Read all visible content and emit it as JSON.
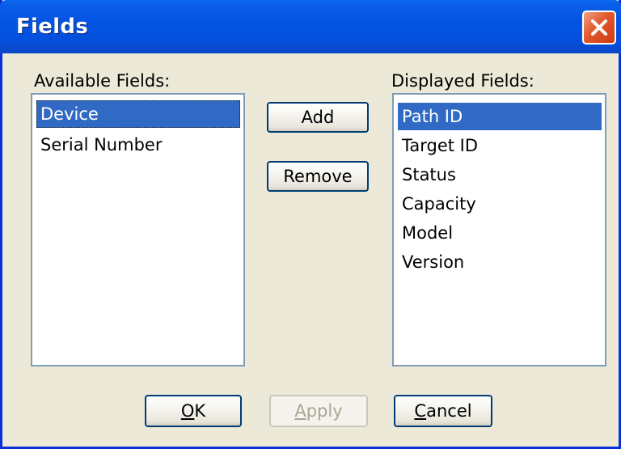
{
  "window": {
    "title": "Fields"
  },
  "available": {
    "label": "Available Fields:",
    "items": [
      "Device",
      "Serial Number"
    ]
  },
  "displayed": {
    "label": "Displayed Fields:",
    "items": [
      "Path ID",
      "Target ID",
      "Status",
      "Capacity",
      "Model",
      "Version"
    ]
  },
  "middle_buttons": {
    "add": "Add",
    "remove": "Remove"
  },
  "footer": {
    "ok_mnemonic": "O",
    "ok_rest": "K",
    "apply_mnemonic": "A",
    "apply_rest": "pply",
    "cancel_mnemonic": "C",
    "cancel_rest": "ancel"
  },
  "colors": {
    "titlebar": "#0454e4",
    "selection": "#316ac5",
    "dialog_bg": "#ece9d8"
  }
}
